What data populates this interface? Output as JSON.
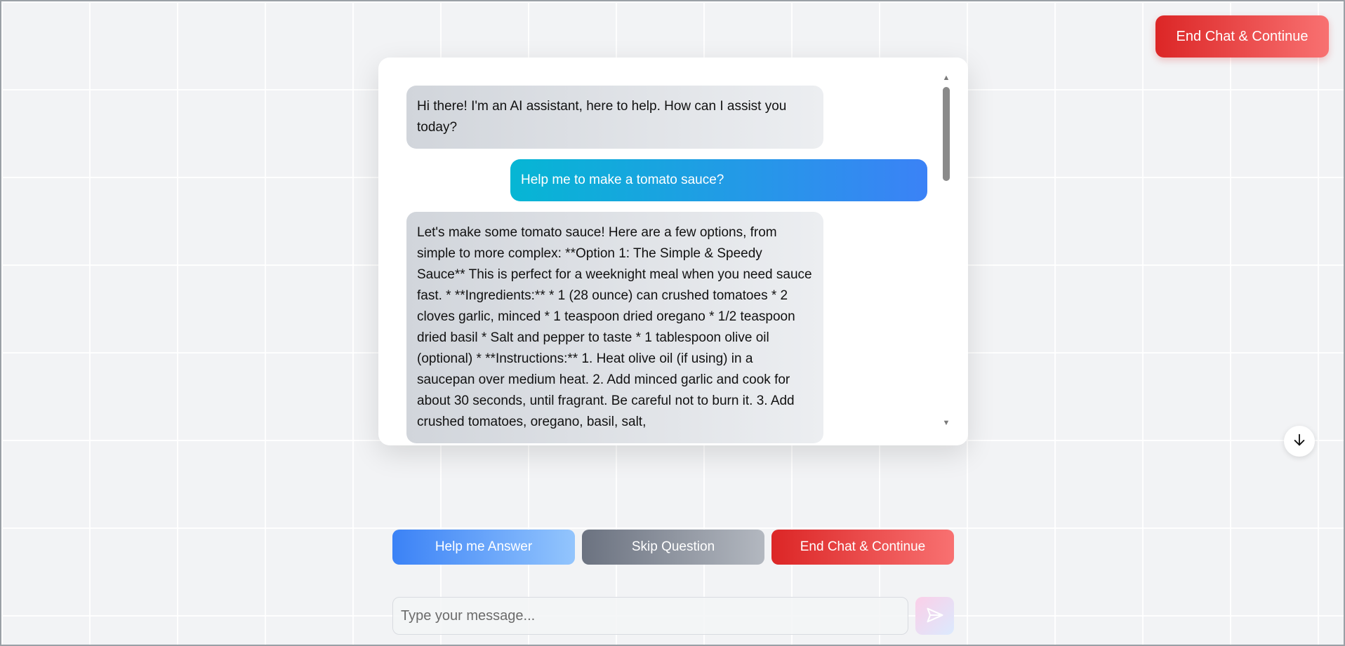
{
  "header": {
    "end_chat_label": "End Chat & Continue"
  },
  "chat": {
    "messages": [
      {
        "role": "assistant",
        "text": "Hi there! I'm an AI assistant, here to help. How can I assist you today?"
      },
      {
        "role": "user",
        "text": "Help me to make a tomato sauce?"
      },
      {
        "role": "assistant",
        "text": "Let's make some tomato sauce! Here are a few options, from simple to more complex: **Option 1: The Simple & Speedy Sauce** This is perfect for a weeknight meal when you need sauce fast. * **Ingredients:** * 1 (28 ounce) can crushed tomatoes * 2 cloves garlic, minced * 1 teaspoon dried oregano * 1/2 teaspoon dried basil * Salt and pepper to taste * 1 tablespoon olive oil (optional) * **Instructions:** 1. Heat olive oil (if using) in a saucepan over medium heat. 2. Add minced garlic and cook for about 30 seconds, until fragrant. Be careful not to burn it. 3. Add crushed tomatoes, oregano, basil, salt,"
      }
    ]
  },
  "actions": {
    "help_label": "Help me Answer",
    "skip_label": "Skip Question",
    "end_label": "End Chat & Continue"
  },
  "composer": {
    "placeholder": "Type your message..."
  },
  "icons": {
    "scroll_down": "arrow-down-icon",
    "send": "send-icon",
    "scroll_up": "scroll-up-arrow-icon",
    "scroll_down_small": "scroll-down-arrow-icon"
  },
  "colors": {
    "end_chat": "#dc2626",
    "help": "#3b82f6",
    "skip": "#6b7280",
    "user_bubble_start": "#06b6d4",
    "user_bubble_end": "#3b82f6"
  }
}
